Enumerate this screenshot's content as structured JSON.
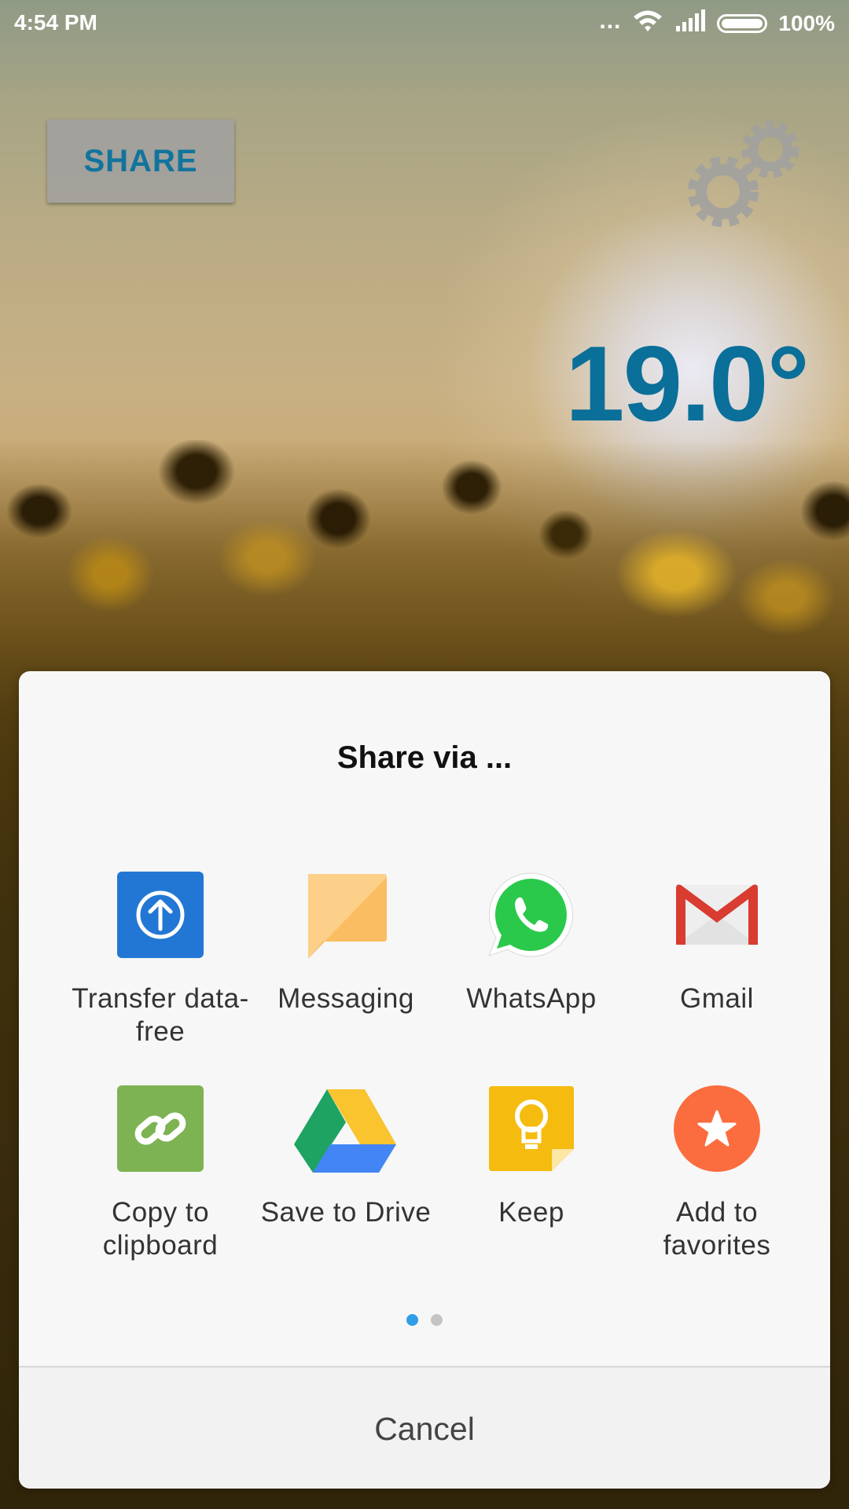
{
  "status_bar": {
    "time": "4:54 PM",
    "more": "...",
    "battery_percent": "100%",
    "icons": [
      "wifi-icon",
      "signal-icon",
      "battery-icon"
    ]
  },
  "app": {
    "share_button": "SHARE",
    "settings_icon": "gear-icon",
    "temperature": "19.0°",
    "accent_color": "#0a6f99"
  },
  "dialog": {
    "title": "Share via ...",
    "cancel": "Cancel",
    "apps": [
      {
        "label": "Transfer data-free",
        "icon": "transfer-data-free-icon",
        "color": "#2377d4"
      },
      {
        "label": "Messaging",
        "icon": "messaging-icon",
        "color": "#fbbd62"
      },
      {
        "label": "WhatsApp",
        "icon": "whatsapp-icon",
        "color": "#2ac94b"
      },
      {
        "label": "Gmail",
        "icon": "gmail-icon",
        "color": "#d93c30"
      },
      {
        "label": "Copy to clipboard",
        "icon": "link-icon",
        "color": "#7db353"
      },
      {
        "label": "Save to Drive",
        "icon": "google-drive-icon",
        "color": "#4385f4"
      },
      {
        "label": "Keep",
        "icon": "keep-icon",
        "color": "#f5bb0f"
      },
      {
        "label": "Add to favorites",
        "icon": "star-icon",
        "color": "#fb6d3e"
      }
    ],
    "page_indicator": {
      "pages": 2,
      "current": 1
    },
    "page_indicator_active_color": "#2f9ee8"
  }
}
